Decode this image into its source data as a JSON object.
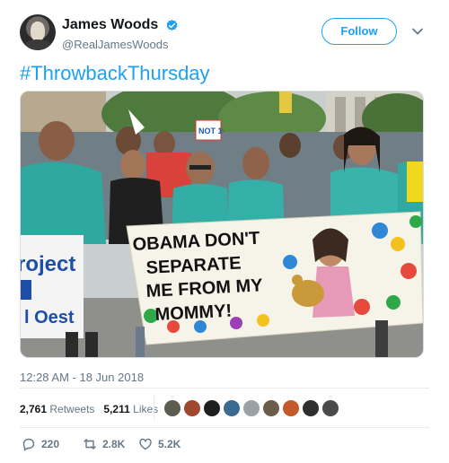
{
  "header": {
    "display_name": "James Woods",
    "handle": "@RealJamesWoods",
    "follow_label": "Follow"
  },
  "tweet": {
    "text": "#ThrowbackThursday",
    "timestamp": "12:28 AM - 18 Jun 2018"
  },
  "photo": {
    "banner_lines": [
      "OBAMA DON'T",
      "SEPARATE",
      "ME FROM MY",
      "MOMMY!"
    ],
    "left_sign_lines": [
      "roject",
      "l Oest"
    ],
    "small_sign": "NOT 1"
  },
  "stats": {
    "retweets_count": "2,761",
    "retweets_label": "Retweets",
    "likes_count": "5,211",
    "likes_label": "Likes"
  },
  "likers": [
    "#5b5b4f",
    "#a0482e",
    "#1f1f1f",
    "#3a6a8c",
    "#9aa2a8",
    "#6b5d4a",
    "#c25b2b",
    "#2e2e2e",
    "#4a4a4a"
  ],
  "actions": {
    "replies": "220",
    "retweets": "2.8K",
    "likes": "5.2K"
  },
  "colors": {
    "accent": "#1da1f2",
    "secondary_text": "#657786"
  }
}
